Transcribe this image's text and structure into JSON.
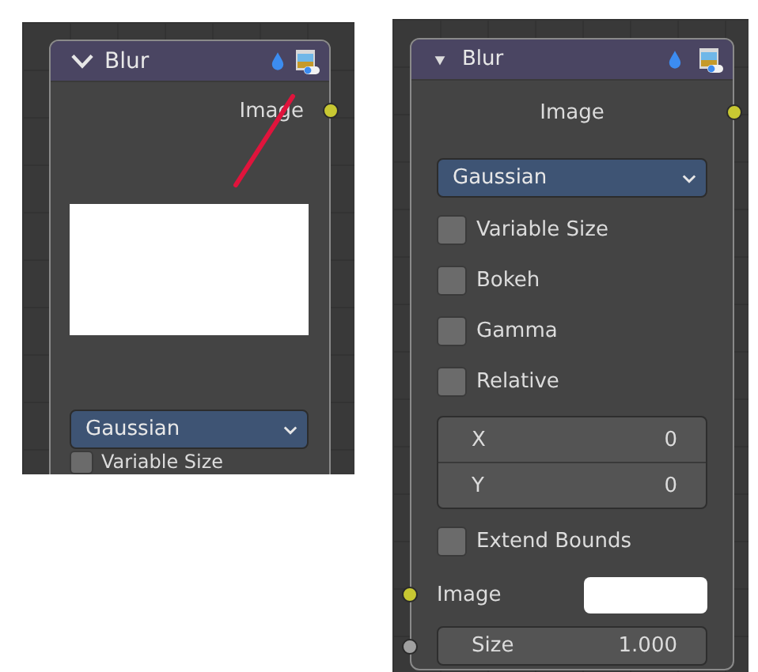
{
  "views": [
    {
      "annotated": true,
      "node": {
        "title": "Blur",
        "toggle": {
          "kind": "chevron"
        },
        "items": [
          {
            "kind": "output",
            "label": "Image"
          },
          {
            "kind": "preview"
          },
          {
            "kind": "dropdown",
            "value": "Gaussian"
          },
          {
            "kind": "checkbox",
            "label": "Variable Size",
            "checked": false
          }
        ]
      }
    },
    {
      "annotated": false,
      "node": {
        "title": "Blur",
        "toggle": {
          "kind": "triangle"
        },
        "items": [
          {
            "kind": "output",
            "label": "Image"
          },
          {
            "kind": "dropdown",
            "value": "Gaussian"
          },
          {
            "kind": "checkbox",
            "label": "Variable Size",
            "checked": false
          },
          {
            "kind": "checkbox",
            "label": "Bokeh",
            "checked": false
          },
          {
            "kind": "checkbox",
            "label": "Gamma",
            "checked": false
          },
          {
            "kind": "checkbox",
            "label": "Relative",
            "checked": false
          },
          {
            "kind": "vector",
            "fields": [
              {
                "label": "X",
                "value": "0"
              },
              {
                "label": "Y",
                "value": "0"
              }
            ]
          },
          {
            "kind": "checkbox",
            "label": "Extend Bounds",
            "checked": false
          },
          {
            "kind": "input",
            "label": "Image",
            "socket": {
              "color": "#c8c832"
            }
          },
          {
            "kind": "number",
            "label": "Size",
            "value": "1.000",
            "socket": {
              "color": "#a0a0a0"
            }
          }
        ]
      }
    }
  ]
}
